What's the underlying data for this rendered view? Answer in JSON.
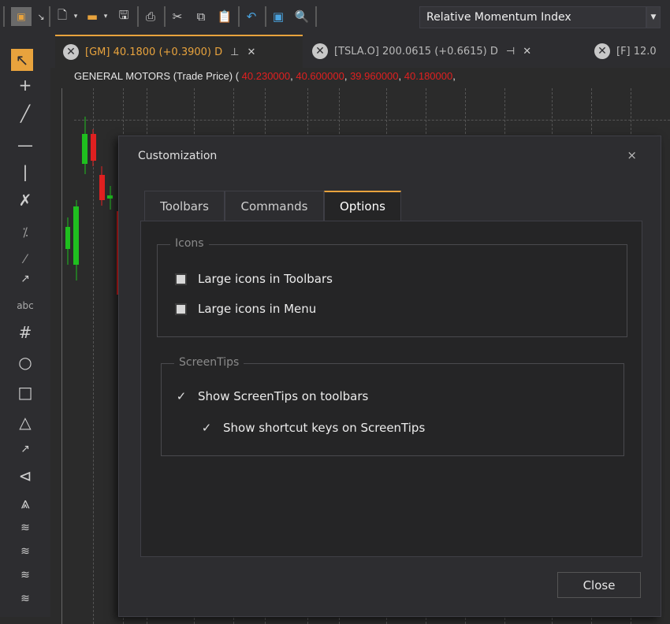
{
  "toolbar": {
    "indicator_value": "Relative Momentum Index"
  },
  "left_tools": {
    "text_tool_label": "abc"
  },
  "tabs": [
    {
      "label": "[GM] 40.1800 (+0.3900) D",
      "active": true
    },
    {
      "label": "[TSLA.O] 200.0615 (+0.6615) D",
      "active": false
    },
    {
      "label": "[F] 12.0",
      "active": false
    }
  ],
  "chart": {
    "title": "GENERAL MOTORS (Trade Price)",
    "open_paren": "(",
    "ohlc": [
      "40.230000",
      "40.600000",
      "39.960000",
      "40.180000"
    ],
    "comma": ",",
    "candle_colors": {
      "up": "#1fbf1f",
      "down": "#e02020"
    }
  },
  "dialog": {
    "title": "Customization",
    "close_icon": "×",
    "tabs": [
      {
        "label": "Toolbars",
        "active": false
      },
      {
        "label": "Commands",
        "active": false
      },
      {
        "label": "Options",
        "active": true
      }
    ],
    "groups": {
      "icons": {
        "title": "Icons",
        "options": [
          {
            "label": "Large icons in Toolbars",
            "checked": false
          },
          {
            "label": "Large icons in Menu",
            "checked": false
          }
        ]
      },
      "screentips": {
        "title": "ScreenTips",
        "options": [
          {
            "label": "Show ScreenTips on toolbars",
            "checked": true
          },
          {
            "label": "Show shortcut keys on ScreenTips",
            "checked": true
          }
        ]
      }
    },
    "close_button": "Close"
  },
  "colors": {
    "accent": "#e8a33d",
    "price_red": "#e02020",
    "background": "#2b2b2b"
  }
}
